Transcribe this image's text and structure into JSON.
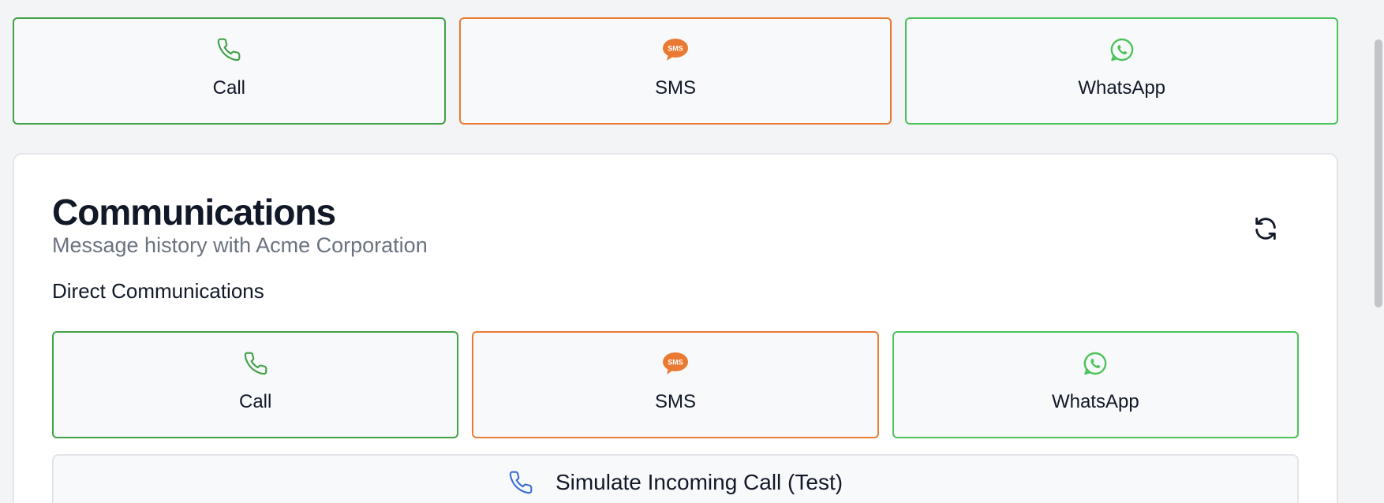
{
  "top_channels": [
    {
      "label": "Call",
      "icon": "phone-icon",
      "color": "#43a047"
    },
    {
      "label": "SMS",
      "icon": "sms-bubble-icon",
      "color": "#ea7a33"
    },
    {
      "label": "WhatsApp",
      "icon": "whatsapp-icon",
      "color": "#4cc35a"
    }
  ],
  "card": {
    "title": "Communications",
    "subtitle": "Message history with Acme Corporation",
    "section_label": "Direct Communications",
    "refresh_icon": "refresh-icon"
  },
  "inner_channels": [
    {
      "label": "Call",
      "icon": "phone-icon",
      "color": "#43a047"
    },
    {
      "label": "SMS",
      "icon": "sms-bubble-icon",
      "color": "#ea7a33"
    },
    {
      "label": "WhatsApp",
      "icon": "whatsapp-icon",
      "color": "#4cc35a"
    }
  ],
  "simulate": {
    "label": "Simulate Incoming Call (Test)",
    "icon": "phone-icon",
    "icon_color": "#3a6fd8"
  },
  "icons": {
    "sms_text": "SMS"
  }
}
